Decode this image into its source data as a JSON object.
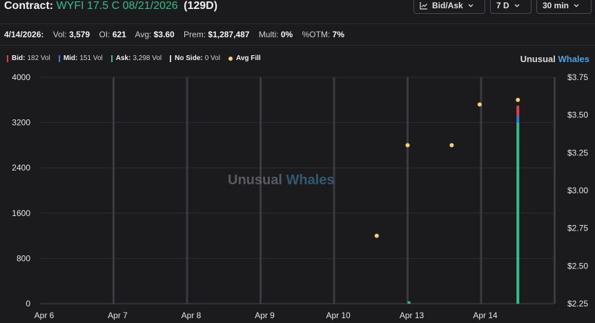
{
  "header": {
    "label": "Contract:",
    "contract": "WYFI 17.5 C 08/21/2026",
    "days": "(129D)",
    "controls": {
      "mode": "Bid/Ask",
      "range": "7 D",
      "interval": "30 min"
    }
  },
  "stats": {
    "date": "4/14/2026:",
    "vol_label": "Vol:",
    "vol": "3,579",
    "oi_label": "OI:",
    "oi": "621",
    "avg_label": "Avg:",
    "avg": "$3.60",
    "prem_label": "Prem:",
    "prem": "$1,287,487",
    "multi_label": "Multi:",
    "multi": "0%",
    "otm_label": "%OTM:",
    "otm": "7%"
  },
  "legend": {
    "bid": {
      "label": "Bid:",
      "text": "182 Vol",
      "color": "#e0404a"
    },
    "mid": {
      "label": "Mid:",
      "text": "151 Vol",
      "color": "#2f7de0"
    },
    "ask": {
      "label": "Ask:",
      "text": "3,298 Vol",
      "color": "#2fbf8a"
    },
    "noside": {
      "label": "No Side:",
      "text": "0 Vol",
      "color": "#d0d0d0"
    },
    "avgfill": {
      "label": "Avg Fill",
      "color": "#f5d27a"
    }
  },
  "brand": {
    "a": "Unusual",
    "b": "Whales"
  },
  "watermark": {
    "a": "Unusual",
    "b": "Whales"
  },
  "chart_data": {
    "type": "bar",
    "x_ticks": [
      "Apr 6",
      "Apr 7",
      "Apr 8",
      "Apr 9",
      "Apr 10",
      "Apr 13",
      "Apr 14"
    ],
    "y_left": {
      "ticks": [
        0,
        800,
        1600,
        2400,
        3200,
        4000
      ],
      "ylim": [
        0,
        4000
      ]
    },
    "y_right": {
      "ticks": [
        "$2.25",
        "$2.50",
        "$2.75",
        "$3.00",
        "$3.25",
        "$3.50",
        "$3.75"
      ],
      "ylim": [
        2.25,
        3.75
      ]
    },
    "x_range": [
      0,
      7.5
    ],
    "grid": true,
    "bars": [
      {
        "x": 5.02,
        "ask": 40,
        "mid": 0,
        "bid": 0
      },
      {
        "x": 6.5,
        "ask": 3200,
        "mid": 120,
        "bid": 180
      }
    ],
    "avg_fill": [
      {
        "x": 4.58,
        "y": 2.7
      },
      {
        "x": 5.0,
        "y": 3.3
      },
      {
        "x": 5.6,
        "y": 3.3
      },
      {
        "x": 5.98,
        "y": 3.57
      },
      {
        "x": 6.5,
        "y": 3.6
      }
    ]
  }
}
